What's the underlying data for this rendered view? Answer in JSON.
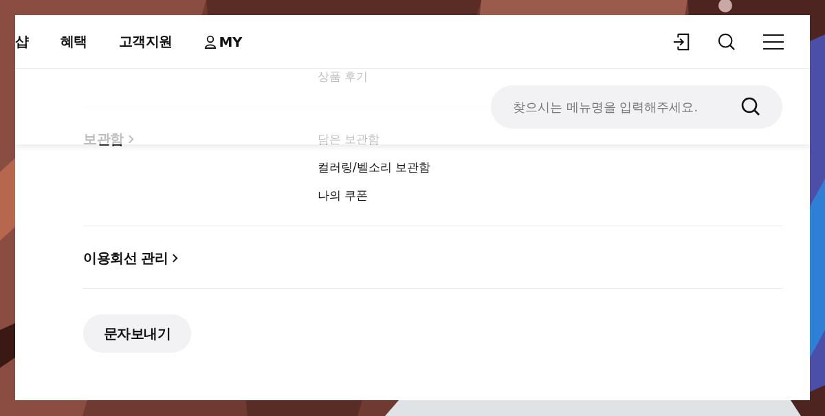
{
  "nav": {
    "items": [
      {
        "label": "샵"
      },
      {
        "label": "혜택"
      },
      {
        "label": "고객지원"
      },
      {
        "label": "MY",
        "kind": "user"
      }
    ]
  },
  "search": {
    "placeholder": "찾으시는 메뉴명을 입력해주세요."
  },
  "sections": [
    {
      "links": [
        "상품 후기"
      ]
    },
    {
      "title": "보관함",
      "links": [
        "담은 보관함",
        "컬러링/벨소리 보관함",
        "나의 쿠폰"
      ]
    },
    {
      "title": "이용회선 관리"
    }
  ],
  "button": "문자보내기"
}
